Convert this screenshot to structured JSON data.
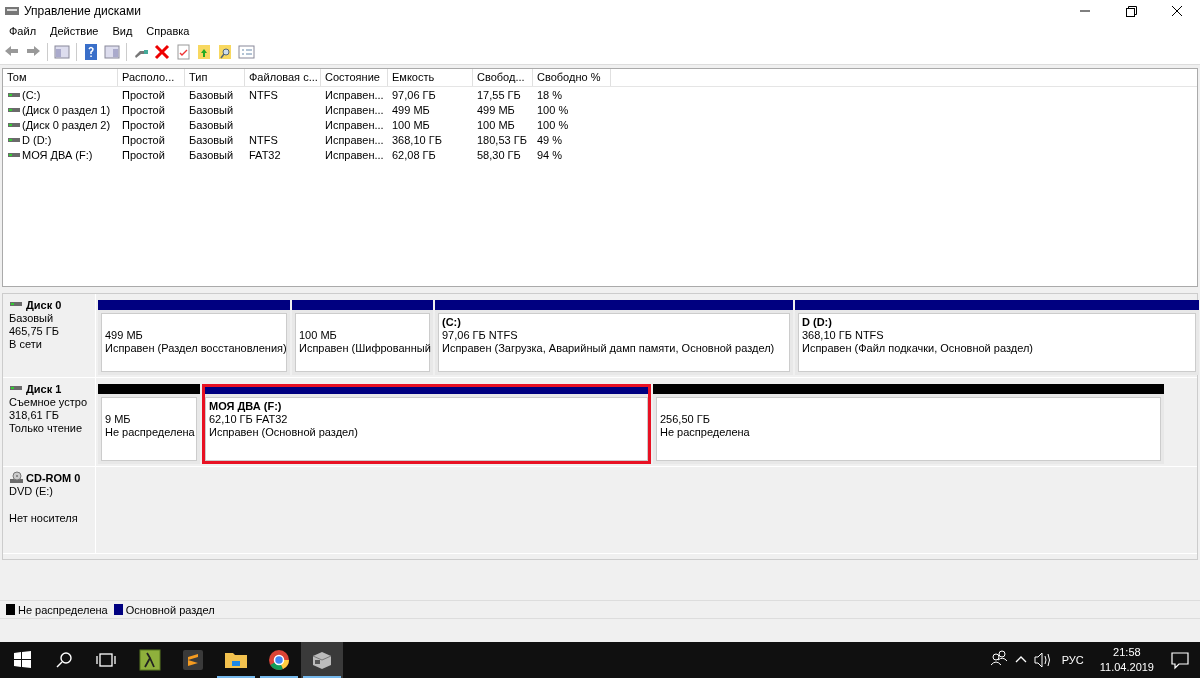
{
  "window": {
    "title": "Управление дисками"
  },
  "menu": [
    "Файл",
    "Действие",
    "Вид",
    "Справка"
  ],
  "volume_table": {
    "columns": [
      "Том",
      "Располо...",
      "Тип",
      "Файловая с...",
      "Состояние",
      "Емкость",
      "Свобод...",
      "Свободно %"
    ],
    "rows": [
      {
        "volume": "(C:)",
        "layout": "Простой",
        "type": "Базовый",
        "file_system": "NTFS",
        "status": "Исправен...",
        "capacity": "97,06 ГБ",
        "free": "17,55 ГБ",
        "free_percent": "18 %"
      },
      {
        "volume": "(Диск 0 раздел 1)",
        "layout": "Простой",
        "type": "Базовый",
        "status": "Исправен...",
        "capacity": "499 МБ",
        "free": "499 МБ",
        "free_percent": "100 %"
      },
      {
        "volume": "(Диск 0 раздел 2)",
        "layout": "Простой",
        "type": "Базовый",
        "status": "Исправен...",
        "capacity": "100 МБ",
        "free": "100 МБ",
        "free_percent": "100 %"
      },
      {
        "volume": "D (D:)",
        "layout": "Простой",
        "type": "Базовый",
        "file_system": "NTFS",
        "status": "Исправен...",
        "capacity": "368,10 ГБ",
        "free": "180,53 ГБ",
        "free_percent": "49 %"
      },
      {
        "volume": "МОЯ ДВА (F:)",
        "layout": "Простой",
        "type": "Базовый",
        "file_system": "FAT32",
        "status": "Исправен...",
        "capacity": "62,08 ГБ",
        "free": "58,30 ГБ",
        "free_percent": "94 %"
      }
    ]
  },
  "disks": [
    {
      "name": "Диск 0",
      "kind": "disk",
      "type": "Базовый",
      "size": "465,75 ГБ",
      "status": "В сети",
      "partitions": [
        {
          "kind": "primary",
          "size": "499 МБ",
          "status": "Исправен (Раздел восстановления)",
          "highlighted": false
        },
        {
          "kind": "primary",
          "size": "100 МБ",
          "status": "Исправен (Шифрованный",
          "highlighted": false
        },
        {
          "kind": "primary",
          "name": "(C:)",
          "size": "97,06 ГБ NTFS",
          "status": "Исправен (Загрузка, Аварийный дамп памяти, Основной раздел)",
          "highlighted": false
        },
        {
          "kind": "primary",
          "name": "D (D:)",
          "size": "368,10 ГБ NTFS",
          "status": "Исправен (Файл подкачки, Основной раздел)",
          "highlighted": false
        }
      ]
    },
    {
      "name": "Диск 1",
      "kind": "disk",
      "type": "Съемное устро",
      "size": "318,61 ГБ",
      "status": "Только чтение",
      "partitions": [
        {
          "kind": "unallocated",
          "size": "9 МБ",
          "status": "Не распределена",
          "highlighted": false
        },
        {
          "kind": "primary",
          "name": "МОЯ ДВА (F:)",
          "size": "62,10 ГБ FAT32",
          "status": "Исправен (Основной раздел)",
          "highlighted": true
        },
        {
          "kind": "unallocated",
          "size": "256,50 ГБ",
          "status": "Не распределена",
          "highlighted": false
        }
      ]
    },
    {
      "name": "CD-ROM 0",
      "kind": "cdrom",
      "type": "DVD (E:)",
      "status": "Нет носителя"
    }
  ],
  "legend": [
    {
      "label": "Не распределена",
      "color": "#000000"
    },
    {
      "label": "Основной раздел",
      "color": "#000080"
    }
  ],
  "taskbar": {
    "apps": [
      {
        "kind": "lambda",
        "running": false,
        "active": false
      },
      {
        "kind": "editor",
        "running": false,
        "active": false
      },
      {
        "kind": "folder",
        "running": true,
        "active": false
      },
      {
        "kind": "browser",
        "running": true,
        "active": false
      },
      {
        "kind": "diskmgmt",
        "running": true,
        "active": true
      }
    ],
    "language": "РУС",
    "time": "21:58",
    "date": "11.04.2019"
  }
}
